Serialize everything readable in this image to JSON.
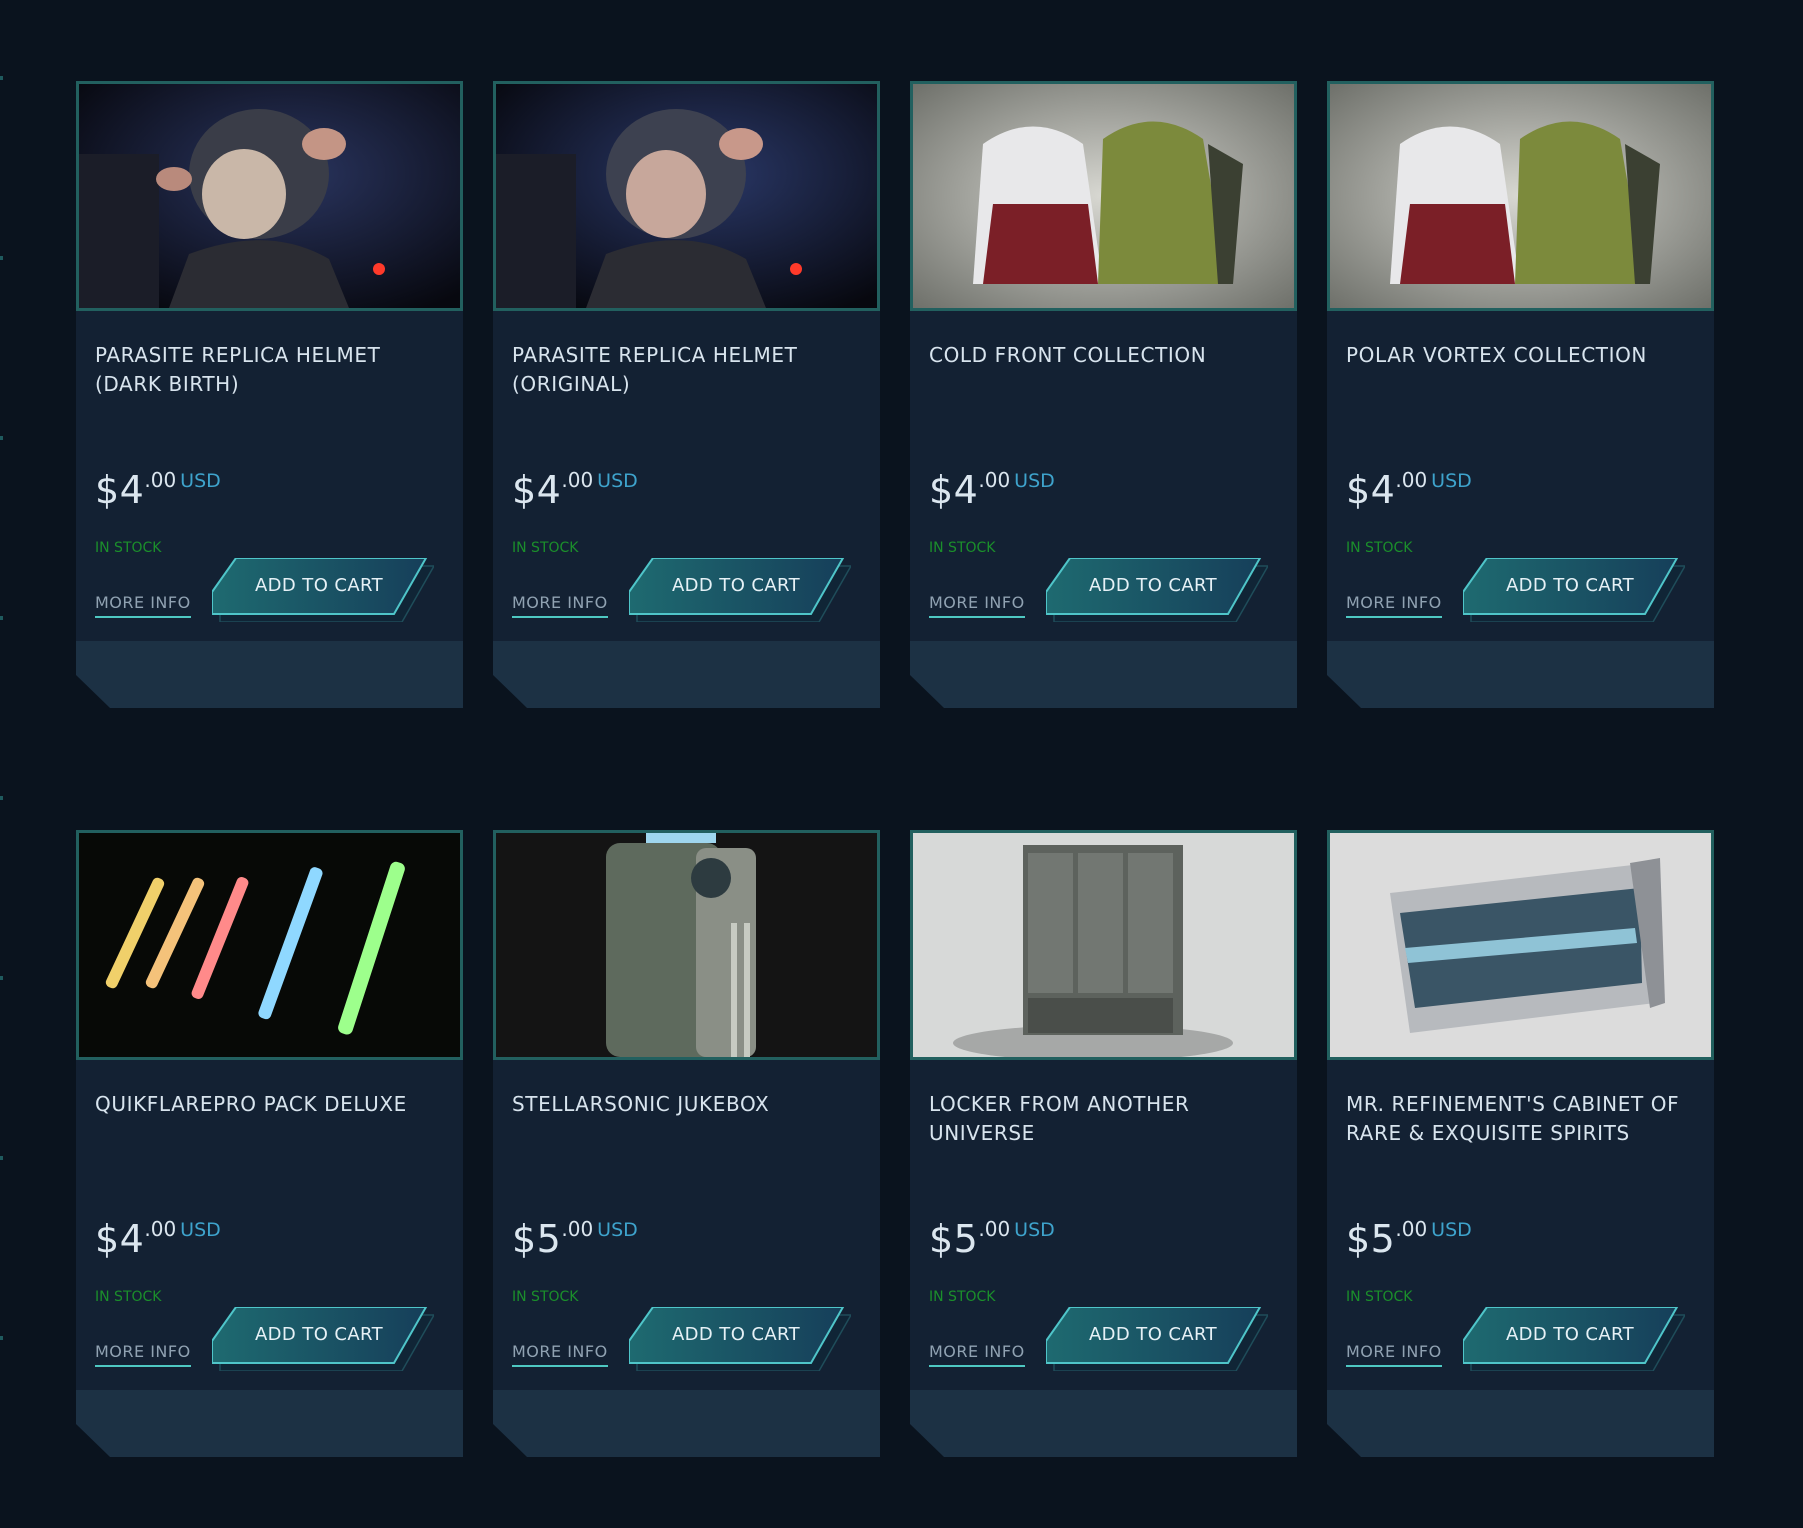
{
  "colors": {
    "background": "#0a131e",
    "card_body": "#132133",
    "card_footer": "#1c3144",
    "image_border": "#22605f",
    "in_stock": "#1b8f2b",
    "currency": "#3ea3cc",
    "accent": "#4ec8c2"
  },
  "products": [
    {
      "title": "PARASITE REPLICA HELMET (DARK BIRTH)",
      "price_whole": "$4",
      "price_cents": ".00",
      "currency": "USD",
      "stock": "IN STOCK",
      "more_info": "MORE INFO",
      "add_to_cart": "ADD TO CART",
      "image_icon": "helmet-dark-birth-image"
    },
    {
      "title": "PARASITE REPLICA HELMET (ORIGINAL)",
      "price_whole": "$4",
      "price_cents": ".00",
      "currency": "USD",
      "stock": "IN STOCK",
      "more_info": "MORE INFO",
      "add_to_cart": "ADD TO CART",
      "image_icon": "helmet-original-image"
    },
    {
      "title": "COLD FRONT COLLECTION",
      "price_whole": "$4",
      "price_cents": ".00",
      "currency": "USD",
      "stock": "IN STOCK",
      "more_info": "MORE INFO",
      "add_to_cart": "ADD TO CART",
      "image_icon": "jackets-image"
    },
    {
      "title": "POLAR VORTEX COLLECTION",
      "price_whole": "$4",
      "price_cents": ".00",
      "currency": "USD",
      "stock": "IN STOCK",
      "more_info": "MORE INFO",
      "add_to_cart": "ADD TO CART",
      "image_icon": "jackets-image"
    },
    {
      "title": "QUIKFLAREPRO PACK DELUXE",
      "price_whole": "$4",
      "price_cents": ".00",
      "currency": "USD",
      "stock": "IN STOCK",
      "more_info": "MORE INFO",
      "add_to_cart": "ADD TO CART",
      "image_icon": "flares-image"
    },
    {
      "title": "STELLARSONIC JUKEBOX",
      "price_whole": "$5",
      "price_cents": ".00",
      "currency": "USD",
      "stock": "IN STOCK",
      "more_info": "MORE INFO",
      "add_to_cart": "ADD TO CART",
      "image_icon": "jukebox-image"
    },
    {
      "title": "LOCKER FROM ANOTHER UNIVERSE",
      "price_whole": "$5",
      "price_cents": ".00",
      "currency": "USD",
      "stock": "IN STOCK",
      "more_info": "MORE INFO",
      "add_to_cart": "ADD TO CART",
      "image_icon": "locker-image"
    },
    {
      "title": "MR. REFINEMENT'S CABINET OF RARE & EXQUISITE SPIRITS",
      "price_whole": "$5",
      "price_cents": ".00",
      "currency": "USD",
      "stock": "IN STOCK",
      "more_info": "MORE INFO",
      "add_to_cart": "ADD TO CART",
      "image_icon": "spirits-cabinet-image"
    }
  ]
}
